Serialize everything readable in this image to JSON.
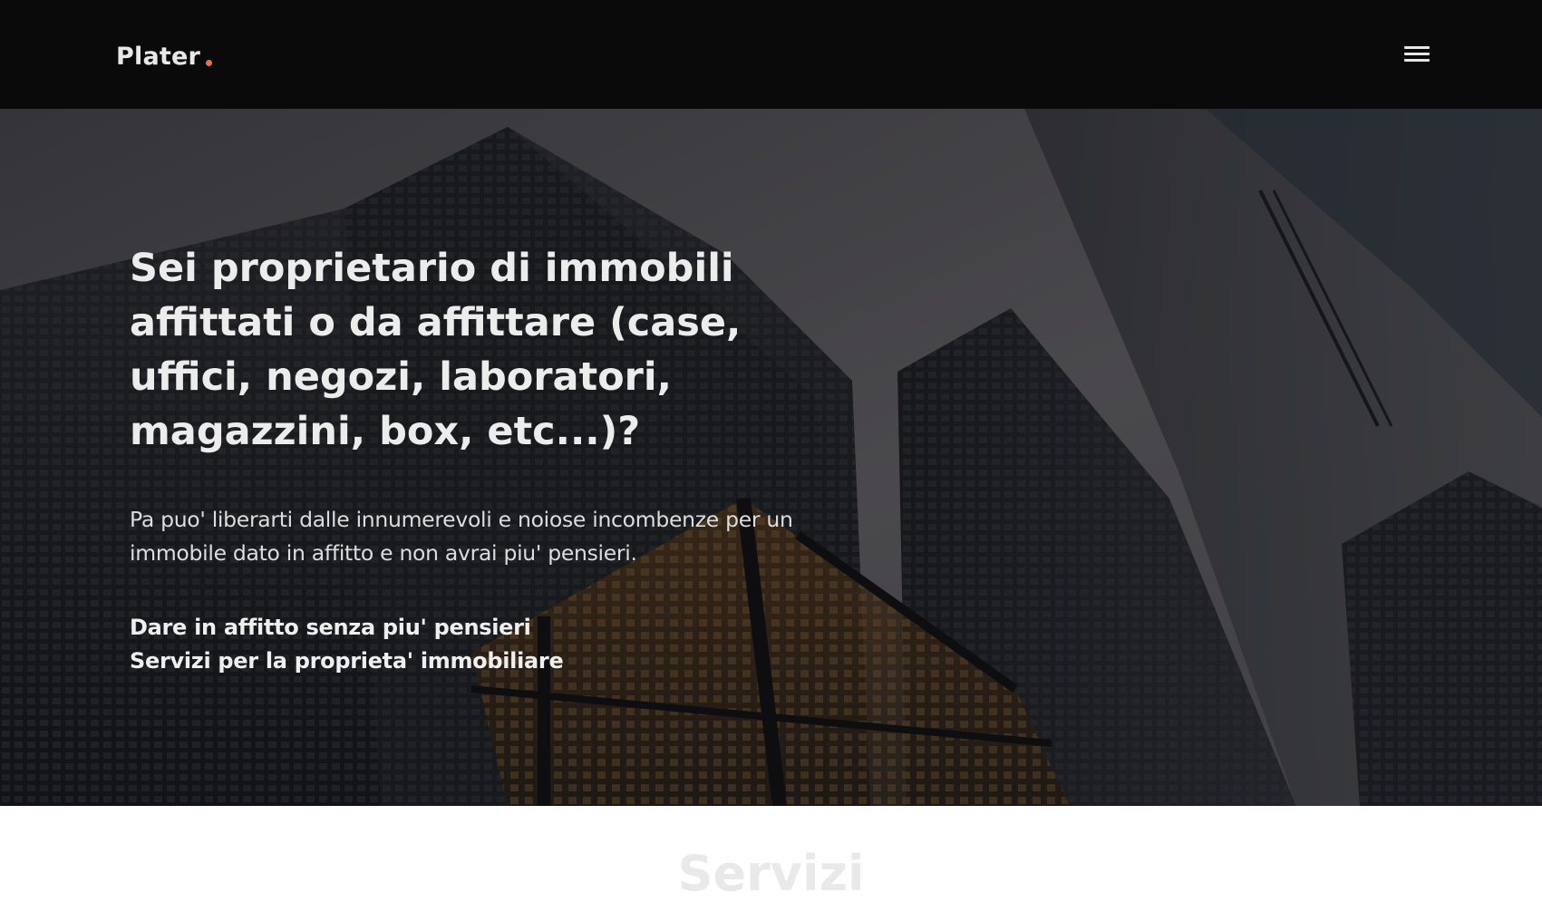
{
  "navbar": {
    "brand": "Plater",
    "brand_dot_color": "#e8763a",
    "menu_icon": "hamburger-menu-icon"
  },
  "hero": {
    "title": "Sei proprietario di immobili affittati o da affittare (case, uffici, negozi, laboratori, magazzini, box, etc...)?",
    "description": "Pa puo' liberarti dalle innumerevoli e noiose incombenze per un immobile dato in affitto e non avrai piu' pensieri.",
    "links": [
      "Dare in affitto senza piu' pensieri",
      "Servizi per la proprieta' immobiliare"
    ]
  },
  "services": {
    "heading": "Servizi"
  }
}
